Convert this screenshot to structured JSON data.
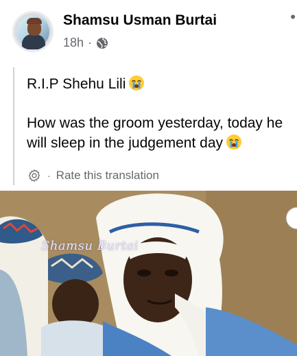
{
  "post": {
    "author": "Shamsu Usman Burtai",
    "time": "18h",
    "audience_icon": "globe-icon",
    "menu_icon": "more-options-icon",
    "line1": "R.I.P Shehu Lili",
    "line2": "How was the groom yesterday, today he will sleep in the judgement day",
    "emoji": "crying-face-emoji"
  },
  "translation": {
    "icon": "gear-icon",
    "separator": "·",
    "label": "Rate this translation"
  },
  "photo": {
    "watermark": "Shamsu Burtai"
  },
  "colors": {
    "text": "#050505",
    "secondary": "#65676b",
    "quote_bar": "#ced0d4"
  }
}
